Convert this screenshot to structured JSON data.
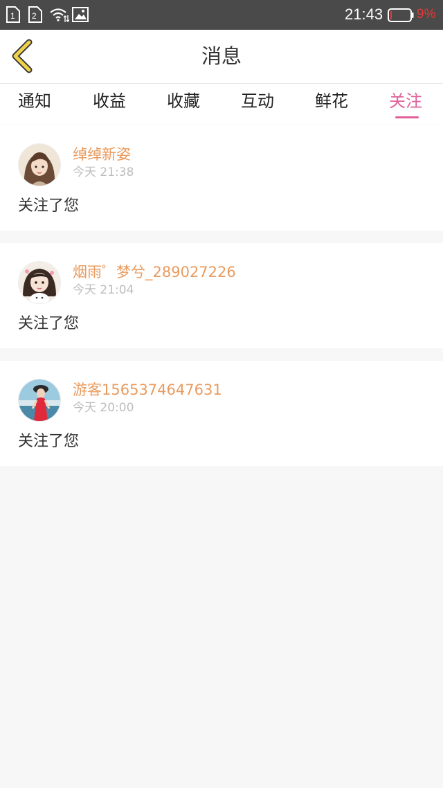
{
  "status_bar": {
    "sim1": "1",
    "sim2": "2",
    "time": "21:43",
    "battery": "9%",
    "battery_color": "#e53935"
  },
  "header": {
    "back_icon": "chevron-left-icon",
    "title": "消息"
  },
  "tabs": [
    {
      "label": "通知",
      "active": false
    },
    {
      "label": "收益",
      "active": false
    },
    {
      "label": "收藏",
      "active": false
    },
    {
      "label": "互动",
      "active": false
    },
    {
      "label": "鲜花",
      "active": false
    },
    {
      "label": "关注",
      "active": true
    }
  ],
  "colors": {
    "accent": "#e0609a",
    "username": "#e99b5f",
    "back_icon": "#f0d24a"
  },
  "notifications": [
    {
      "user": "绰绰新姿",
      "time": "今天 21:38",
      "message": "关注了您"
    },
    {
      "user": "烟雨゜梦兮_289027226",
      "time": "今天 21:04",
      "message": "关注了您"
    },
    {
      "user": "游客1565374647631",
      "time": "今天 20:00",
      "message": "关注了您"
    }
  ]
}
